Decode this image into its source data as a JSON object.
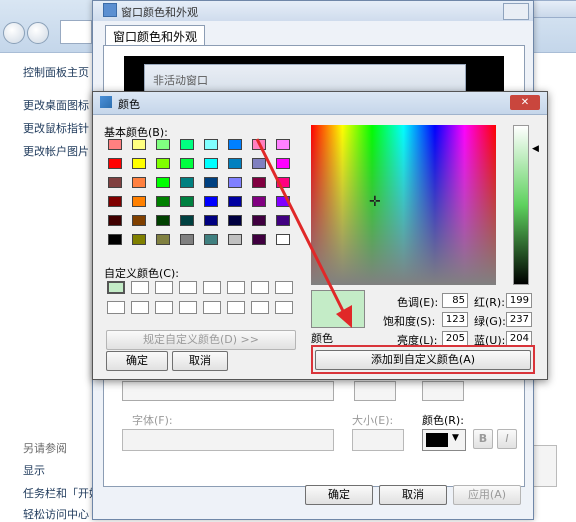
{
  "control_panel": {
    "links": [
      "控制面板主页",
      "更改桌面图标",
      "更改鼠标指针",
      "更改帐户图片"
    ],
    "see_also": "另请参阅",
    "bottom_links": [
      "显示",
      "任务栏和「开始」",
      "轻松访问中心"
    ]
  },
  "window_dialog": {
    "title": "窗口颜色和外观",
    "tab": "窗口颜色和外观",
    "inactive_window": "非活动窗口",
    "font_label": "字体(F):",
    "size_label": "大小(E):",
    "color_label": "颜色(R):",
    "bold": "B",
    "italic": "I",
    "ok": "确定",
    "cancel": "取消",
    "apply": "应用(A)"
  },
  "color_dialog": {
    "title": "颜色",
    "basic_colors_label": "基本颜色(B):",
    "basic_colors": [
      [
        "#ff8080",
        "#ffff80",
        "#80ff80",
        "#00ff80",
        "#80ffff",
        "#0080ff",
        "#ff80c0",
        "#ff80ff"
      ],
      [
        "#ff0000",
        "#ffff00",
        "#80ff00",
        "#00ff40",
        "#00ffff",
        "#0080c0",
        "#8080c0",
        "#ff00ff"
      ],
      [
        "#804040",
        "#ff8040",
        "#00ff00",
        "#008080",
        "#004080",
        "#8080ff",
        "#800040",
        "#ff0080"
      ],
      [
        "#800000",
        "#ff8000",
        "#008000",
        "#008040",
        "#0000ff",
        "#0000a0",
        "#800080",
        "#8000ff"
      ],
      [
        "#400000",
        "#804000",
        "#004000",
        "#004040",
        "#000080",
        "#000040",
        "#400040",
        "#400080"
      ],
      [
        "#000000",
        "#808000",
        "#808040",
        "#808080",
        "#408080",
        "#c0c0c0",
        "#400040",
        "#ffffff"
      ]
    ],
    "custom_colors_label": "自定义颜色(C):",
    "define_custom": "规定自定义颜色(D) >>",
    "ok": "确定",
    "cancel": "取消",
    "color_solid_label": "颜色",
    "hue_label": "色调(E):",
    "hue": "85",
    "sat_label": "饱和度(S):",
    "sat": "123",
    "lum_label": "亮度(L):",
    "lum": "205",
    "red_label": "红(R):",
    "red": "199",
    "green_label": "绿(G):",
    "green": "237",
    "blue_label": "蓝(U):",
    "blue": "204",
    "add_custom": "添加到自定义颜色(A)",
    "close": "✕"
  }
}
